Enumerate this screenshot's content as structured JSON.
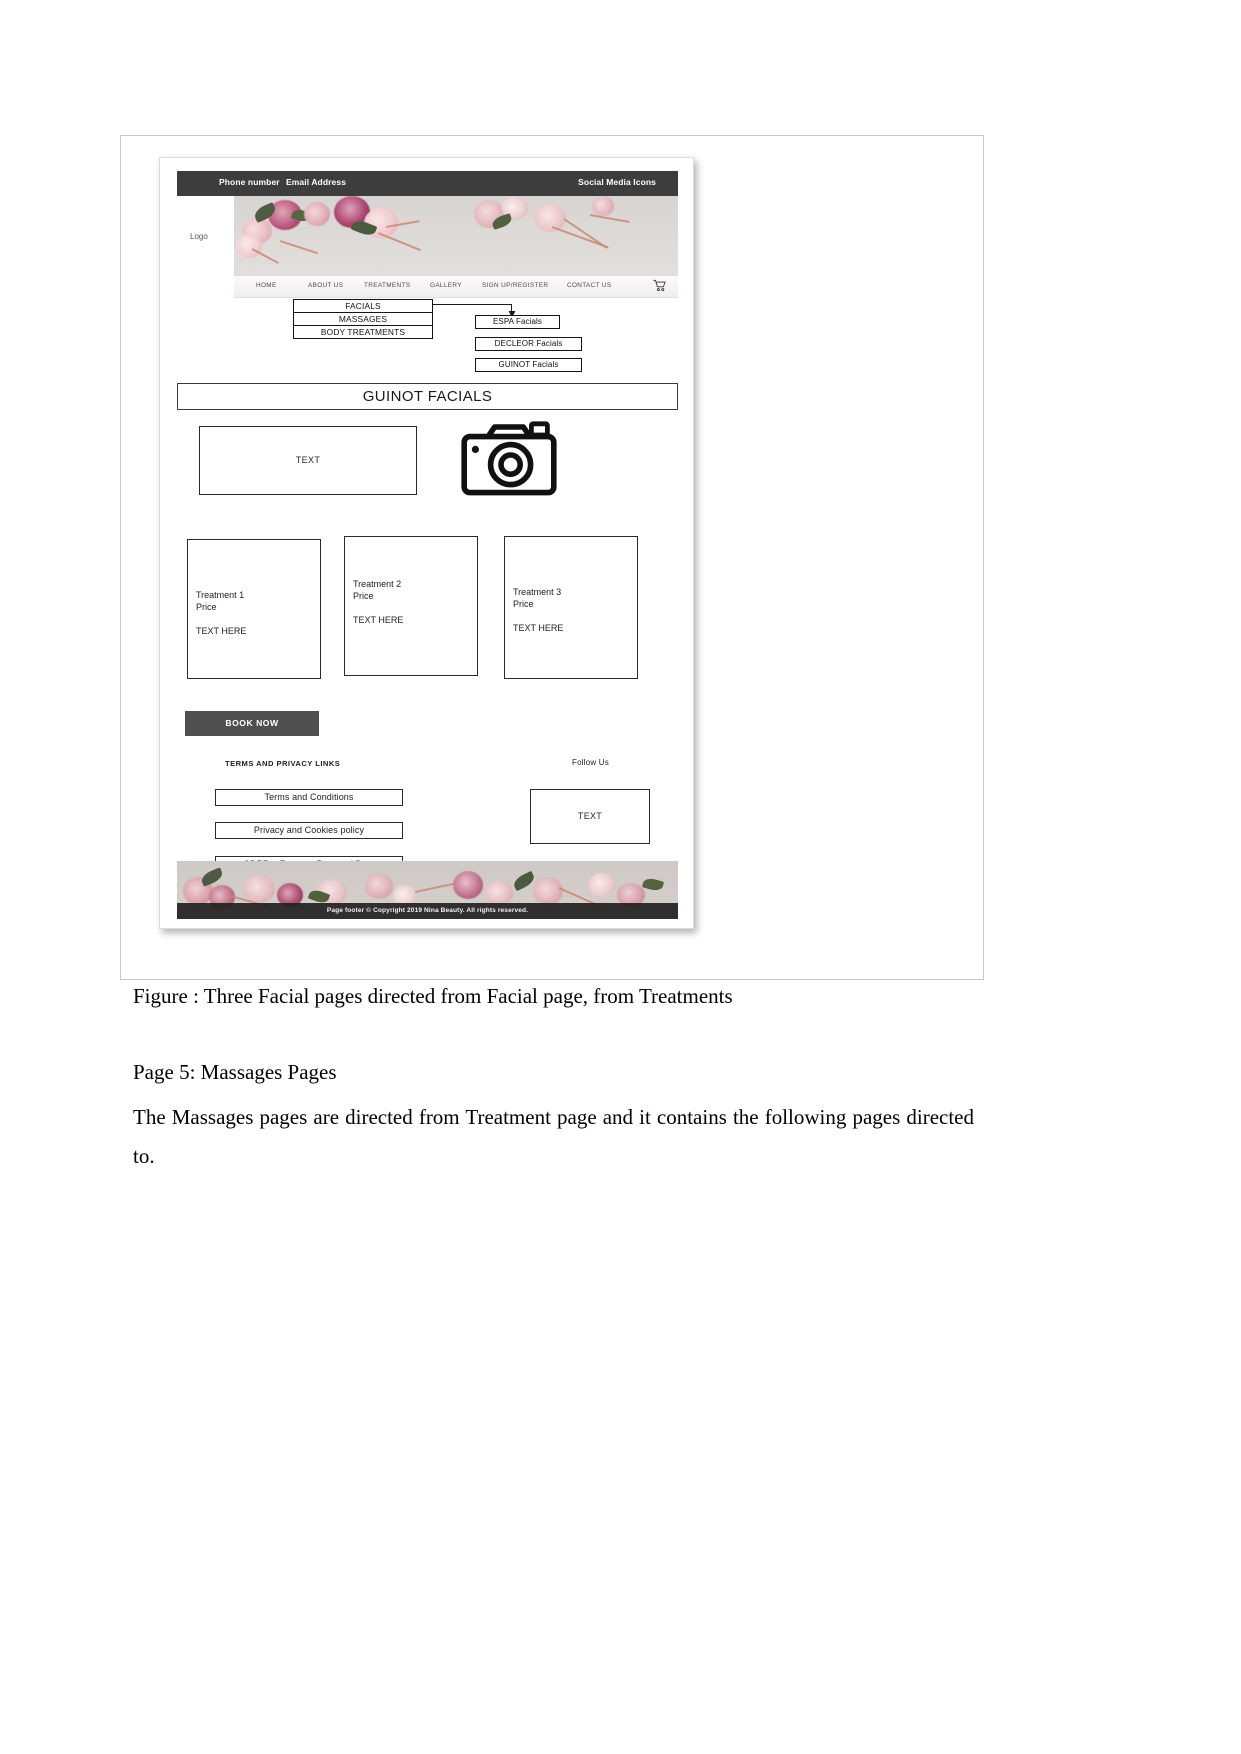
{
  "document": {
    "caption": "Figure : Three Facial pages directed from Facial page, from Treatments",
    "section_heading": "Page 5: Massages Pages",
    "paragraph": "The Massages pages are directed from Treatment page and it contains the following pages directed to."
  },
  "wireframe": {
    "topbar": {
      "phone_label": "Phone number",
      "email_label": "Email Address",
      "social_label": "Social Media Icons",
      "background_color": "#3d3d3d"
    },
    "logo": {
      "label": "Logo"
    },
    "nav": {
      "items": [
        {
          "label": "HOME"
        },
        {
          "label": "ABOUT US"
        },
        {
          "label": "TREATMENTS"
        },
        {
          "label": "GALLERY"
        },
        {
          "label": "SIGN UP/REGISTER"
        },
        {
          "label": "CONTACT US"
        }
      ],
      "cart_icon": "shopping-cart-icon"
    },
    "dropdown_primary": {
      "items": [
        {
          "label": "FACIALS"
        },
        {
          "label": "MASSAGES"
        },
        {
          "label": "BODY TREATMENTS"
        }
      ]
    },
    "dropdown_secondary": {
      "items": [
        {
          "label": "ESPA Facials"
        },
        {
          "label": "DECLEOR Facials"
        },
        {
          "label": "GUINOT Facials"
        }
      ]
    },
    "page_title": "GUINOT FACIALS",
    "intro_textbox": "TEXT",
    "image_placeholder_icon": "camera-icon",
    "treatments": [
      {
        "name": "Treatment 1",
        "price_label": "Price",
        "body": "TEXT HERE"
      },
      {
        "name": "Treatment 2",
        "price_label": "Price",
        "body": "TEXT HERE"
      },
      {
        "name": "Treatment 3",
        "price_label": "Price",
        "body": "TEXT HERE"
      }
    ],
    "book_now_label": "BOOK NOW",
    "footer": {
      "terms_heading": "TERMS AND PRIVACY LINKS",
      "links": [
        {
          "label": "Terms and Conditions"
        },
        {
          "label": "Privacy and Cookies policy"
        },
        {
          "label": "GDPR – Request Personal Data"
        }
      ],
      "follow_heading": "Follow Us",
      "follow_box_label": "TEXT",
      "copyright": "Page footer  © Copyright 2019 Nina  Beauty. All rights reserved."
    }
  }
}
